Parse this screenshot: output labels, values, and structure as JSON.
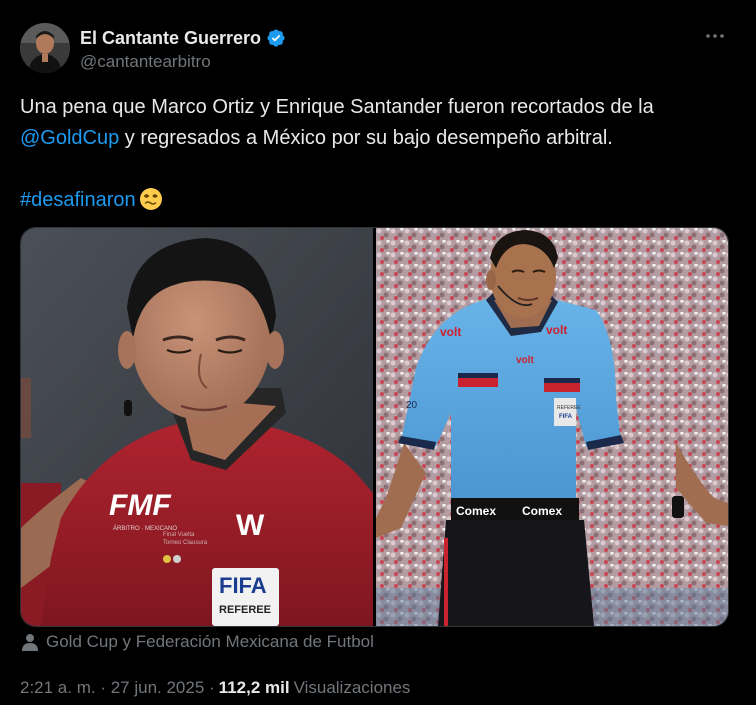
{
  "author": {
    "display_name": "El Cantante Guerrero",
    "handle": "@cantantearbitro",
    "verified": true
  },
  "tweet": {
    "text_part1": "Una pena que Marco Ortiz y Enrique Santander fueron recortados de la ",
    "mention": "@GoldCup",
    "text_part2": " y regresados a México por su bajo desempeño arbitral.",
    "hashtag": "#desafinaron",
    "emoji": "woozy-face"
  },
  "media": {
    "left_photo": {
      "jersey_text_1": "FMF",
      "jersey_text_2": "W",
      "badge_top": "FIFA",
      "badge_bottom": "REFEREE"
    },
    "right_photo": {
      "sponsor_1": "volt",
      "belt_text_1": "Comex",
      "belt_text_2": "Comex"
    },
    "credit": "Gold Cup y Federación Mexicana de Futbol"
  },
  "meta": {
    "timestamp": "2:21 a. m. · 27 jun. 2025 · ",
    "views_count": "112,2 mil",
    "views_label": "Visualizaciones"
  },
  "colors": {
    "background": "#000000",
    "text": "#e7e9ea",
    "muted": "#71767b",
    "link": "#1d9bf0",
    "verified": "#1d9bf0"
  }
}
